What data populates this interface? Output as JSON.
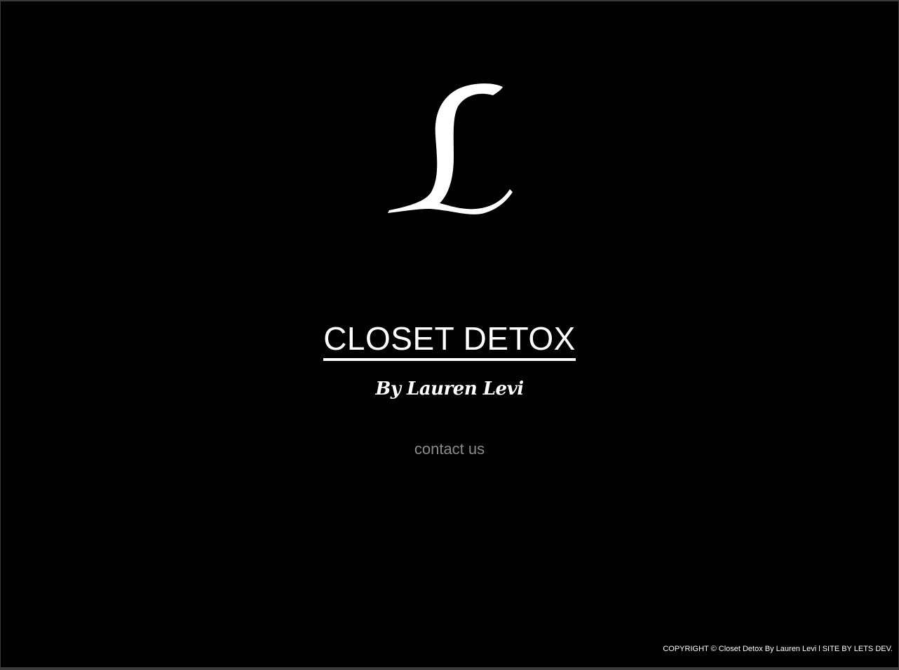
{
  "logo": {
    "icon": "script-letter-l-icon",
    "letter": "L"
  },
  "title": "CLOSET DETOX",
  "byline": "By Lauren Levi",
  "contact_link": "contact us",
  "footer": "COPYRIGHT © Closet Detox By Lauren Levi l SITE BY LETS DEV.",
  "colors": {
    "background": "#000000",
    "text": "#ffffff",
    "muted_link": "#8a8a8a"
  }
}
